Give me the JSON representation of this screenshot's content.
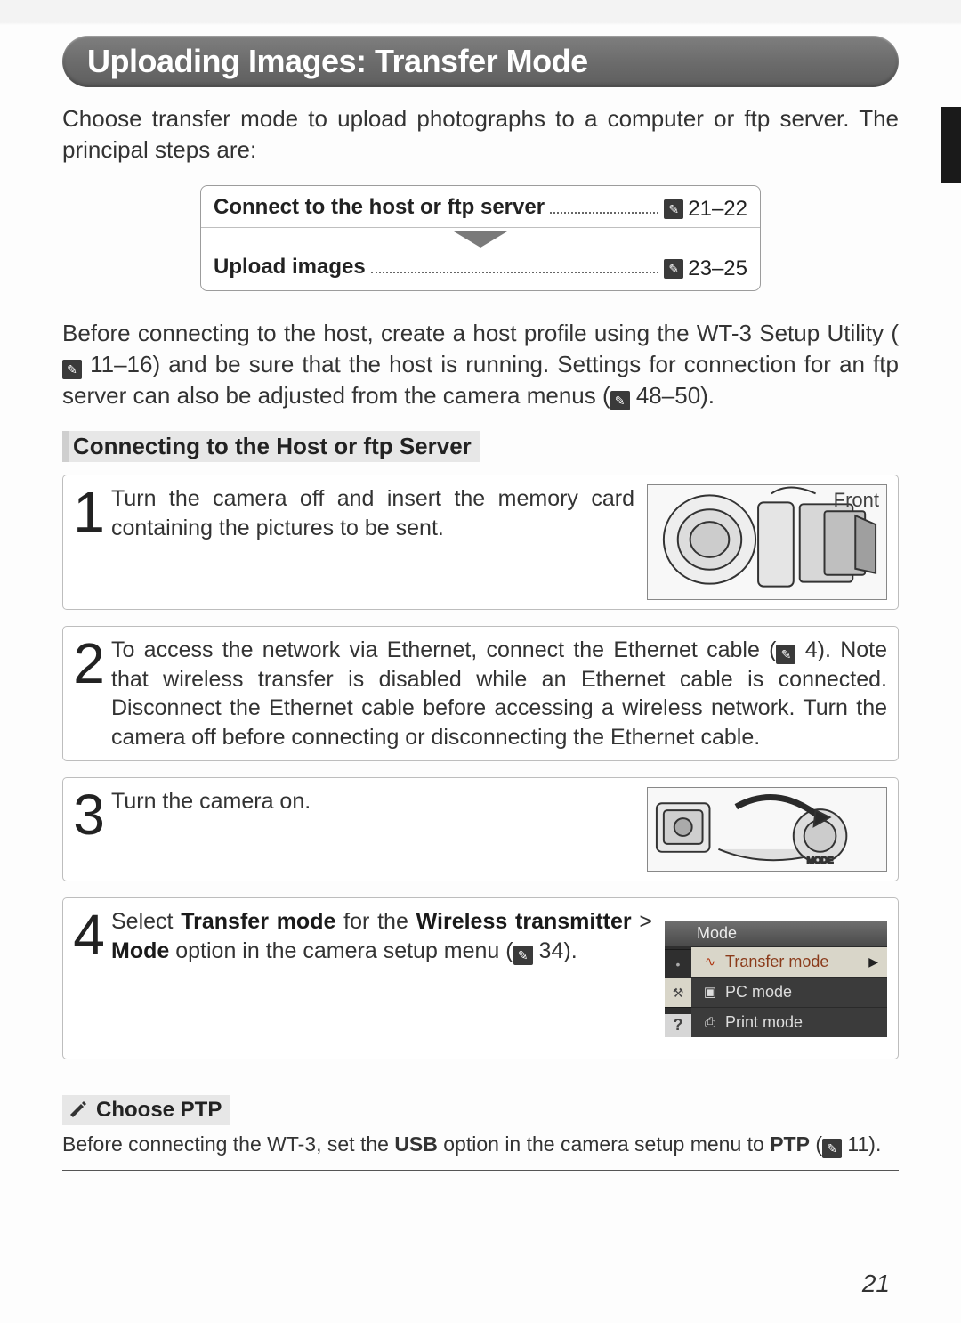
{
  "title": "Uploading Images: Transfer Mode",
  "intro": "Choose transfer mode to upload photographs to a computer or ftp server.  The principal steps are:",
  "flow": {
    "row1_label": "Connect to the host or ftp server",
    "row1_pages": "21–22",
    "row2_label": "Upload images",
    "row2_pages": "23–25"
  },
  "para2_a": "Before connecting to the host, create a host profile using the WT-3 Setup Utility (",
  "para2_b": " 11–16) and be sure that the host is running.  Settings for connection for an ftp server can also be adjusted from the camera menus (",
  "para2_c": " 48–50).",
  "subhead": "Connecting to the Host or ftp Server",
  "steps": {
    "s1_num": "1",
    "s1_text": "Turn the camera off and insert the memory card containing the pictures to be sent.",
    "s1_illust_label": "Front",
    "s2_num": "2",
    "s2_a": "To access the network via Ethernet, connect the Ethernet cable (",
    "s2_b": " 4).  Note that wireless transfer is disabled while an Ethernet cable is connected.  Disconnect the Ethernet cable before accessing a wireless network.  Turn the camera off before connecting or disconnecting the Ethernet cable.",
    "s3_num": "3",
    "s3_text": "Turn the camera on.",
    "s4_num": "4",
    "s4_a": "Select ",
    "s4_b": "Transfer mode",
    "s4_c": " for the ",
    "s4_d": "Wireless transmitter",
    "s4_e": " > ",
    "s4_f": "Mode",
    "s4_g": " option in the camera setup menu (",
    "s4_h": " 34)."
  },
  "menu": {
    "title": "Mode",
    "items": [
      {
        "label": "Transfer mode",
        "selected": true,
        "icon": "~"
      },
      {
        "label": "PC mode",
        "selected": false,
        "icon": "▣"
      },
      {
        "label": "Print mode",
        "selected": false,
        "icon": "⎙"
      }
    ],
    "side": [
      "▸",
      "●",
      "⚒",
      "▯",
      "?"
    ]
  },
  "note": {
    "head": "Choose PTP",
    "body_a": "Before connecting the WT-3, set the ",
    "body_b": "USB",
    "body_c": " option in the camera setup menu to ",
    "body_d": "PTP",
    "body_e": " (",
    "body_f": " 11)."
  },
  "page_number": "21"
}
